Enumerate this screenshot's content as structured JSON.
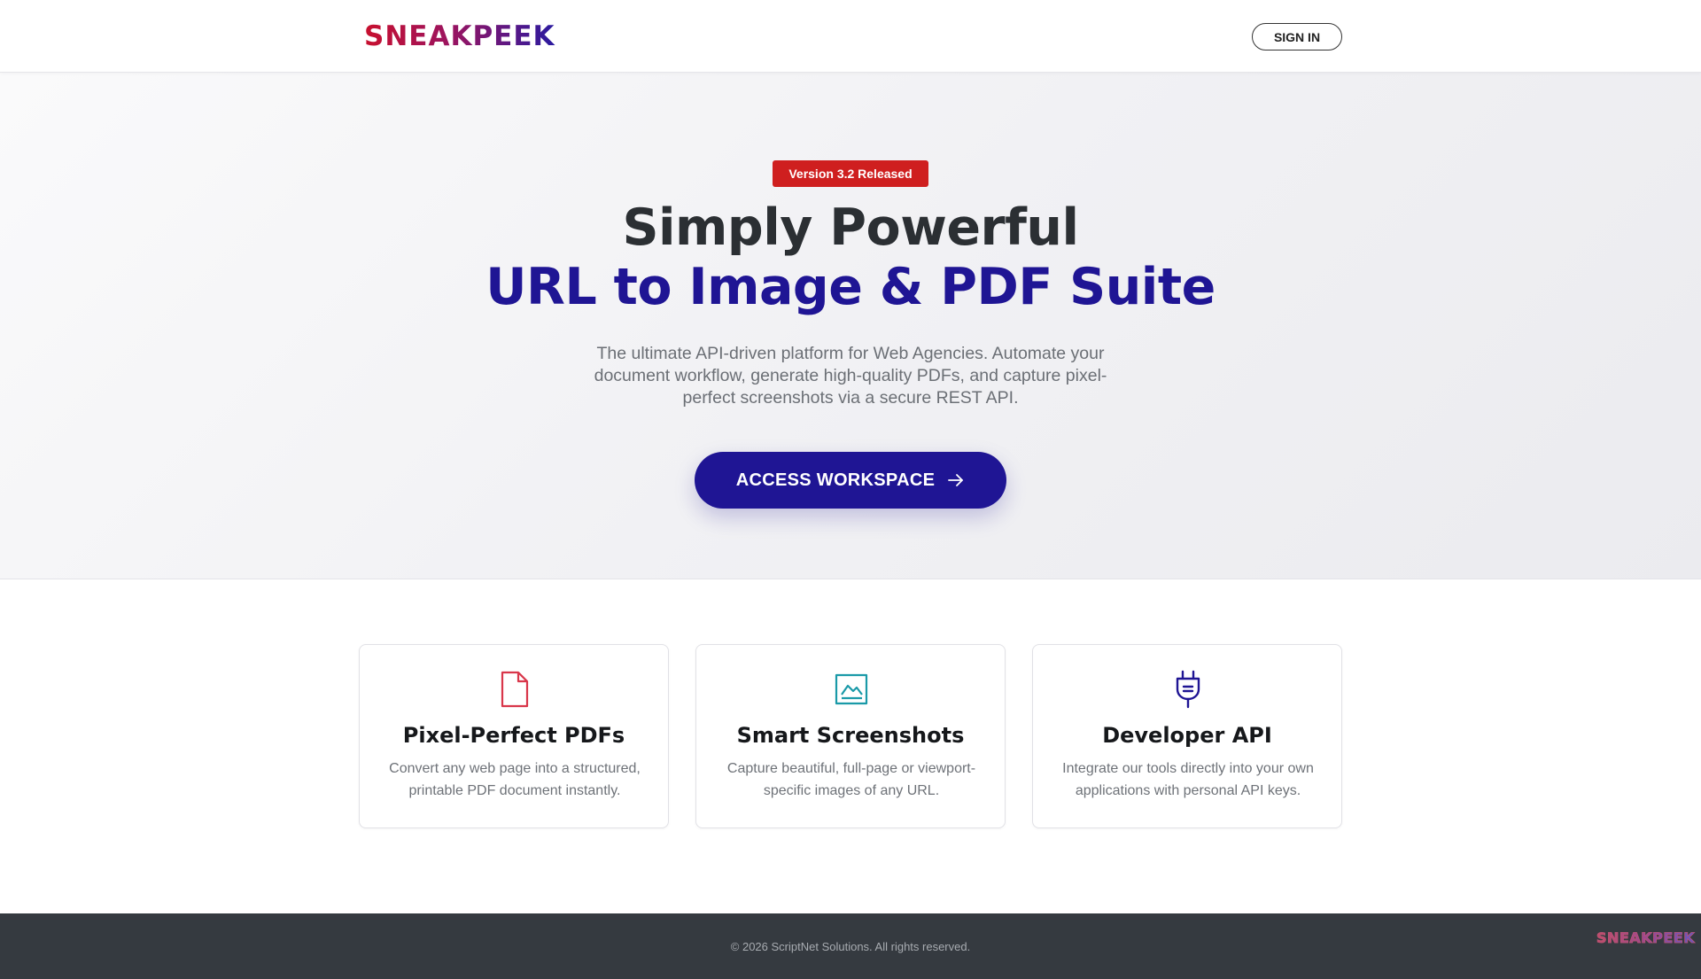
{
  "header": {
    "logo_text": "SNEAKPEEK",
    "signin_label": "SIGN IN"
  },
  "hero": {
    "badge": "Version 3.2 Released",
    "title_line1": "Simply Powerful",
    "title_line2": "URL to Image & PDF Suite",
    "subtitle": "The ultimate API-driven platform for Web Agencies. Automate your document workflow, generate high-quality PDFs, and capture pixel-perfect screenshots via a secure REST API.",
    "cta_label": "ACCESS WORKSPACE",
    "cta_icon": "arrow-right-icon"
  },
  "features": [
    {
      "icon": "file-icon",
      "title": "Pixel-Perfect PDFs",
      "description": "Convert any web page into a structured, printable PDF document instantly."
    },
    {
      "icon": "image-icon",
      "title": "Smart Screenshots",
      "description": "Capture beautiful, full-page or viewport-specific images of any URL."
    },
    {
      "icon": "plug-icon",
      "title": "Developer API",
      "description": "Integrate our tools directly into your own applications with personal API keys."
    }
  ],
  "footer": {
    "copyright": "© 2026 ScriptNet Solutions. All rights reserved.",
    "logo_text": "SNEAKPEEK"
  },
  "colors": {
    "brand_primary": "#1f1594",
    "brand_red": "#cf1f1f",
    "footer_bg": "#353a40",
    "icon_pdf": "#d9364a",
    "icon_screenshot": "#1a9aa8",
    "icon_api": "#1f1594"
  }
}
